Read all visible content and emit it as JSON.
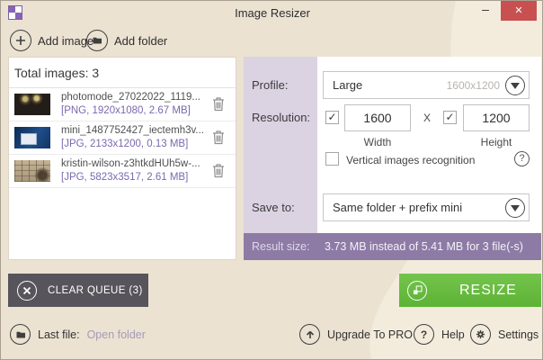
{
  "window": {
    "title": "Image Resizer",
    "minimize_glyph": "–",
    "close_glyph": "✕"
  },
  "toolbar": {
    "add_image": "Add image",
    "add_folder": "Add folder"
  },
  "queue": {
    "header": "Total images: 3",
    "items": [
      {
        "name": "photomode_27022022_1119...",
        "meta": "[PNG, 1920x1080, 2.67 MB]"
      },
      {
        "name": "mini_1487752427_iectemh3v...",
        "meta": "[JPG, 2133x1200, 0.13 MB]"
      },
      {
        "name": "kristin-wilson-z3htkdHUh5w-...",
        "meta": "[JPG, 5823x3517, 2.61 MB]"
      }
    ]
  },
  "settings": {
    "profile_label": "Profile:",
    "profile_value": "Large",
    "profile_dimensions": "1600x1200",
    "resolution_label": "Resolution:",
    "width_value": "1600",
    "height_value": "1200",
    "x_separator": "X",
    "width_label": "Width",
    "height_label": "Height",
    "vertical_recognition_label": "Vertical images recognition",
    "help_glyph": "?",
    "save_to_label": "Save to:",
    "save_to_value": "Same folder + prefix mini",
    "result_label": "Result size:",
    "result_value": "3.73 MB instead of 5.41 MB for 3 file(-s)"
  },
  "actions": {
    "clear_queue": "CLEAR QUEUE (3)",
    "resize": "RESIZE"
  },
  "footer": {
    "last_file_label": "Last file:",
    "open_folder_link": "Open folder",
    "upgrade": "Upgrade To PRO",
    "help": "Help",
    "settings": "Settings"
  },
  "colors": {
    "window_background": "#ebe2d2",
    "accent_purple": "#8d7ba6",
    "label_column_purple": "#dbd2e2",
    "meta_text_purple": "#7b68ae",
    "resize_green": "#63b93c",
    "clear_button_gray": "#57545b",
    "close_button_red": "#c85050"
  }
}
